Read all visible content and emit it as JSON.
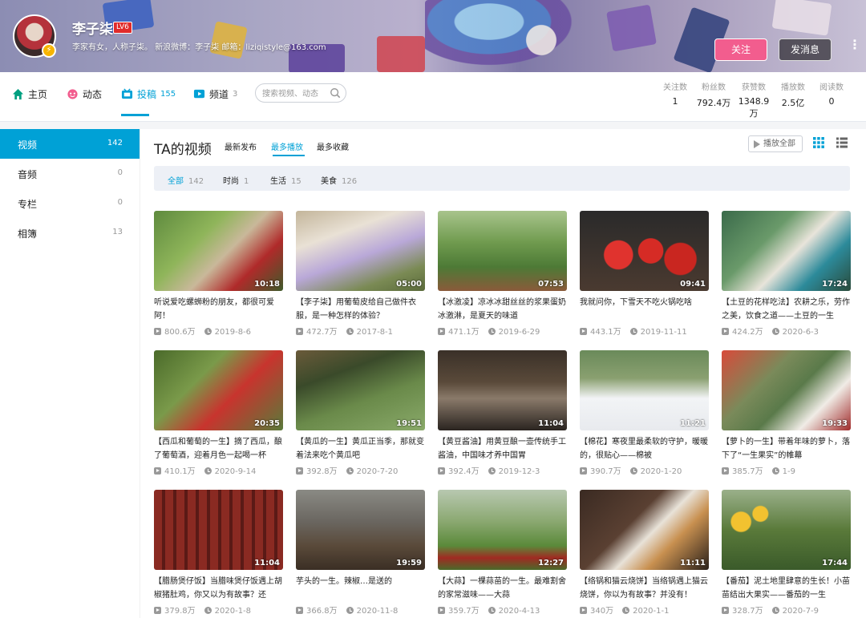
{
  "profile": {
    "name": "李子柒",
    "level": "LV6",
    "signature": "李家有女，人称子柒。 新浪微博：李子柒 邮箱：liziqistyle@163.com",
    "follow_label": "关注",
    "message_label": "发消息",
    "more_label": "⋮"
  },
  "nav": {
    "tabs": [
      {
        "label": "主页",
        "count": ""
      },
      {
        "label": "动态",
        "count": ""
      },
      {
        "label": "投稿",
        "count": "155"
      },
      {
        "label": "频道",
        "count": "3"
      }
    ],
    "search_placeholder": "搜索视频、动态"
  },
  "stats": [
    {
      "label": "关注数",
      "value": "1"
    },
    {
      "label": "粉丝数",
      "value": "792.4万"
    },
    {
      "label": "获赞数",
      "value": "1348.9万"
    },
    {
      "label": "播放数",
      "value": "2.5亿"
    },
    {
      "label": "阅读数",
      "value": "0"
    }
  ],
  "sidebar": {
    "items": [
      {
        "label": "视频",
        "count": "142"
      },
      {
        "label": "音频",
        "count": "0"
      },
      {
        "label": "专栏",
        "count": "0"
      },
      {
        "label": "相簿",
        "count": "13"
      }
    ]
  },
  "main": {
    "title": "TA的视频",
    "sort_tabs": [
      "最新发布",
      "最多播放",
      "最多收藏"
    ],
    "play_all_label": "播放全部",
    "filters": [
      {
        "label": "全部",
        "count": "142"
      },
      {
        "label": "时尚",
        "count": "1"
      },
      {
        "label": "生活",
        "count": "15"
      },
      {
        "label": "美食",
        "count": "126"
      }
    ]
  },
  "videos": [
    {
      "title": "听说爱吃螺蛳粉的朋友，都很可爱阿！",
      "duration": "10:18",
      "plays": "800.6万",
      "date": "2019-8-6"
    },
    {
      "title": "【李子柒】用葡萄皮给自己做件衣服，是一种怎样的体验？",
      "duration": "05:00",
      "plays": "472.7万",
      "date": "2017-8-1"
    },
    {
      "title": "【冰激凌】凉冰冰甜丝丝的浆果蛋奶冰激淋，是夏天的味道",
      "duration": "07:53",
      "plays": "471.1万",
      "date": "2019-6-29"
    },
    {
      "title": "我就问你，下雪天不吃火锅吃啥",
      "duration": "09:41",
      "plays": "443.1万",
      "date": "2019-11-11"
    },
    {
      "title": "【土豆的花样吃法】农耕之乐，劳作之美，饮食之道——土豆的一生",
      "duration": "17:24",
      "plays": "424.2万",
      "date": "2020-6-3"
    },
    {
      "title": "【西瓜和葡萄的一生】摘了西瓜，酿了葡萄酒，迎着月色一起喝一杯",
      "duration": "20:35",
      "plays": "410.1万",
      "date": "2020-9-14"
    },
    {
      "title": "【黄瓜的一生】黄瓜正当季，那就变着法来吃个黄瓜吧",
      "duration": "19:51",
      "plays": "392.8万",
      "date": "2020-7-20"
    },
    {
      "title": "【黄豆酱油】用黄豆酿一壶传统手工酱油，中国味才养中国胃",
      "duration": "11:04",
      "plays": "392.4万",
      "date": "2019-12-3"
    },
    {
      "title": "【棉花】寒夜里最柔软的守护，暖暖的，很贴心——棉被",
      "duration": "11:21",
      "plays": "390.7万",
      "date": "2020-1-20"
    },
    {
      "title": "【萝卜的一生】带着年味的萝卜，落下了“一生果实”的帷幕",
      "duration": "19:33",
      "plays": "385.7万",
      "date": "1-9"
    },
    {
      "title": "【腊肠煲仔饭】当腊味煲仔饭遇上胡椒猪肚鸡，你又以为有故事？还",
      "duration": "11:04",
      "plays": "379.8万",
      "date": "2020-1-8"
    },
    {
      "title": "芋头的一生。辣椒…是送的",
      "duration": "19:59",
      "plays": "366.8万",
      "date": "2020-11-8"
    },
    {
      "title": "【大蒜】一棵蒜苗的一生。最难割舍的家常滋味——大蒜",
      "duration": "12:27",
      "plays": "359.7万",
      "date": "2020-4-13"
    },
    {
      "title": "【络锅和猫云烧饼】当络锅遇上猫云烧饼，你以为有故事？并没有！",
      "duration": "11:11",
      "plays": "340万",
      "date": "2020-1-1"
    },
    {
      "title": "【番茄】泥土地里肆意的生长！小苗苗结出大果实——番茄的一生",
      "duration": "17:44",
      "plays": "328.7万",
      "date": "2020-7-9"
    }
  ],
  "colors": {
    "accent": "#00a1d6",
    "follow_button": "#f25d8e",
    "level_badge": "#e02b2b",
    "filter_bar": "#edf0f6"
  },
  "icons": {
    "home": "home-icon",
    "dynamic": "dynamic-icon",
    "upload": "video-icon",
    "channel": "channel-icon",
    "search": "search-icon",
    "play_all": "play-icon",
    "grid": "grid-view-icon",
    "list": "list-view-icon",
    "play_count": "play-count-icon",
    "date": "clock-icon"
  }
}
